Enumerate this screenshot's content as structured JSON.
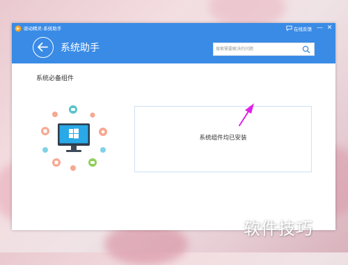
{
  "window": {
    "title": "驱动精灵-系统助手",
    "feedback_label": "在线反馈",
    "minimize_glyph": "—",
    "close_glyph": "✕"
  },
  "header": {
    "page_title": "系统助手",
    "search_placeholder": "搜索需要解决的问题",
    "accent_color": "#3a8be6"
  },
  "main": {
    "section_label": "系统必备组件",
    "status_text": "系统组件均已安装"
  },
  "illustration": {
    "icons": [
      "monitor-icon",
      "windows-logo-icon",
      "gamepad-icon",
      "settings-icon",
      "chip-icon",
      "puzzle-icon"
    ]
  },
  "watermark": {
    "text": "软件技巧"
  },
  "annotation": {
    "arrow_color": "#e020e8"
  }
}
